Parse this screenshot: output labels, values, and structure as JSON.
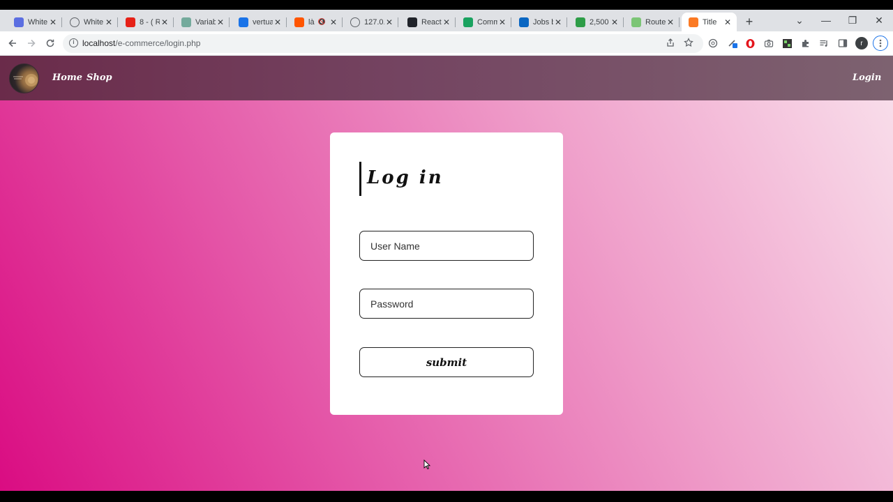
{
  "browser": {
    "tabs": [
      {
        "label": "White",
        "icon": "app-icon",
        "color": "#5b6ee1"
      },
      {
        "label": "White",
        "icon": "globe-icon",
        "color": "#5f6368"
      },
      {
        "label": "8 - ( R",
        "icon": "youtube-icon",
        "color": "#e62117"
      },
      {
        "label": "Variab",
        "icon": "openai-icon",
        "color": "#74aa9c"
      },
      {
        "label": "vertua",
        "icon": "share-icon",
        "color": "#1a73e8"
      },
      {
        "label": "là",
        "icon": "soundcloud-icon",
        "color": "#ff5500",
        "muted": true
      },
      {
        "label": "127.0.",
        "icon": "globe-icon",
        "color": "#5f6368"
      },
      {
        "label": "React",
        "icon": "react-icon",
        "color": "#20232a"
      },
      {
        "label": "Comm",
        "icon": "sheets-icon",
        "color": "#1aa260"
      },
      {
        "label": "Jobs b",
        "icon": "linkedin-icon",
        "color": "#0a66c2"
      },
      {
        "label": "2,500",
        "icon": "calc-icon",
        "color": "#2e9d48"
      },
      {
        "label": "Route",
        "icon": "heart-icon",
        "color": "#7cc576"
      },
      {
        "label": "Title",
        "icon": "xampp-icon",
        "color": "#fb7a24",
        "active": true
      }
    ],
    "address": {
      "host": "localhost",
      "path": "/e-commerce/login.php"
    },
    "profile_initial": "r"
  },
  "site": {
    "nav": {
      "home": "Home",
      "shop": "Shop",
      "login": "Login"
    },
    "login_form": {
      "title": "Log in",
      "username_placeholder": "User Name",
      "password_placeholder": "Password",
      "submit_label": "submit"
    }
  }
}
